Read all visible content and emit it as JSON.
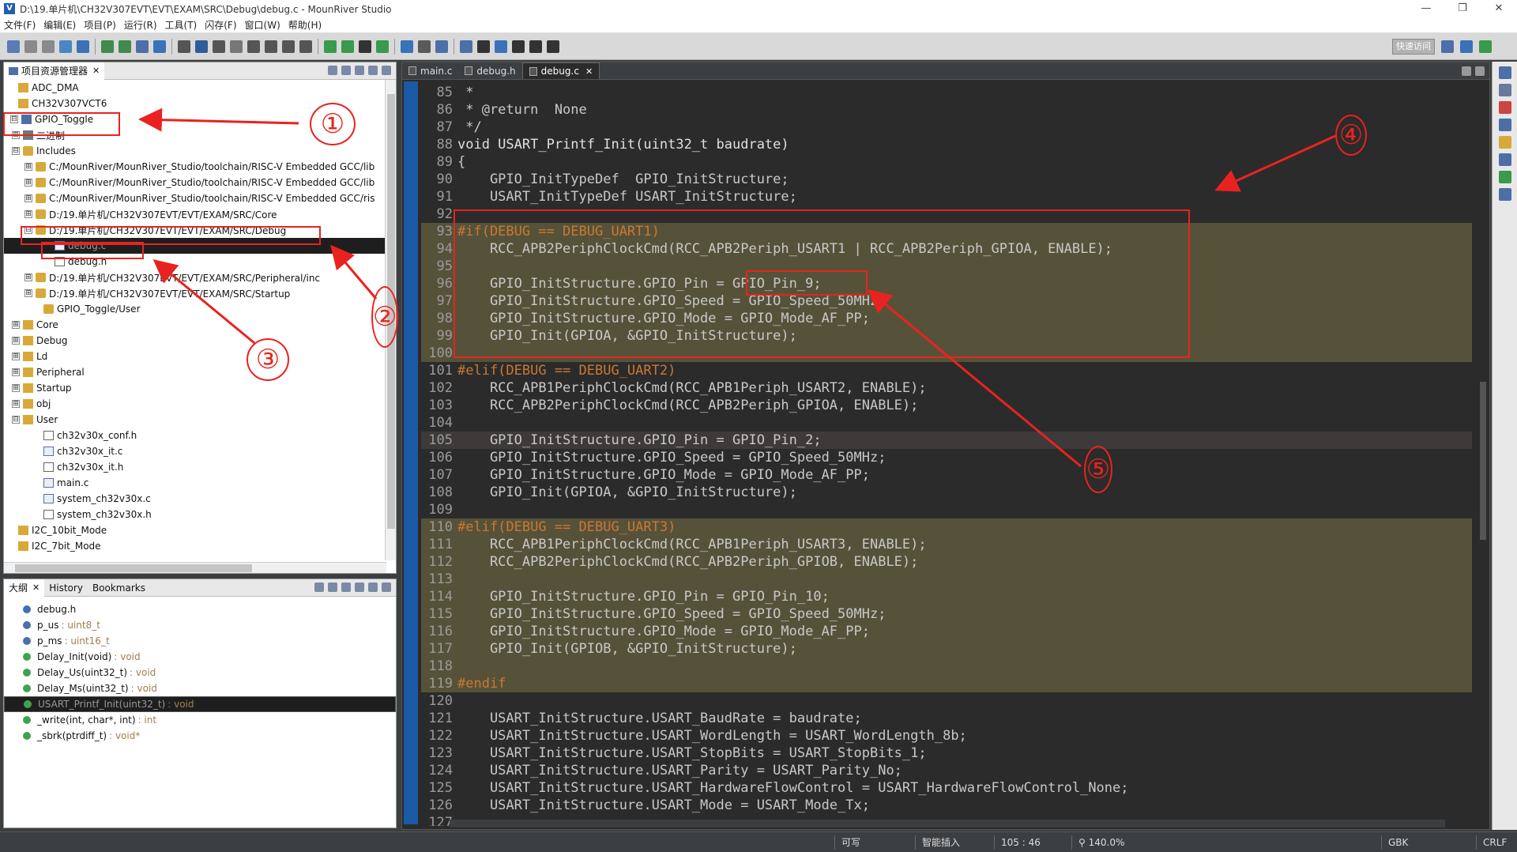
{
  "window": {
    "title": "D:\\19.单片机\\CH32V307EVT\\EVT\\EXAM\\SRC\\Debug\\debug.c - MounRiver Studio",
    "min": "—",
    "max": "❐",
    "close": "✕"
  },
  "menu": [
    "文件(F)",
    "编辑(E)",
    "项目(P)",
    "运行(R)",
    "工具(T)",
    "闪存(F)",
    "窗口(W)",
    "帮助(H)"
  ],
  "toolbar": {
    "quick_access": "快速访问"
  },
  "explorer": {
    "tab_label": "项目资源管理器",
    "rows": [
      {
        "label": "ADC_DMA",
        "icon": "folder-icon"
      },
      {
        "label": "CH32V307VCT6",
        "icon": "folder-icon"
      },
      {
        "label": "GPIO_Toggle",
        "icon": "project-icon",
        "toggle": "⊟"
      },
      {
        "label": "二进制",
        "icon": "binary-icon",
        "toggle": "⊞"
      },
      {
        "label": "Includes",
        "icon": "includes-icon",
        "toggle": "⊟"
      },
      {
        "label": "C:/MounRiver/MounRiver_Studio/toolchain/RISC-V Embedded GCC/lib",
        "icon": "include-folder-icon",
        "toggle": "⊞"
      },
      {
        "label": "C:/MounRiver/MounRiver_Studio/toolchain/RISC-V Embedded GCC/lib",
        "icon": "include-folder-icon",
        "toggle": "⊞"
      },
      {
        "label": "C:/MounRiver/MounRiver_Studio/toolchain/RISC-V Embedded GCC/ris",
        "icon": "include-folder-icon",
        "toggle": "⊞"
      },
      {
        "label": "D:/19.单片机/CH32V307EVT/EVT/EXAM/SRC/Core",
        "icon": "include-folder-icon",
        "toggle": "⊞"
      },
      {
        "label": "D:/19.单片机/CH32V307EVT/EVT/EXAM/SRC/Debug",
        "icon": "include-folder-icon",
        "toggle": "⊟"
      },
      {
        "label": "debug.c",
        "icon": "c-file-icon",
        "selected": true
      },
      {
        "label": "debug.h",
        "icon": "h-file-icon"
      },
      {
        "label": "D:/19.单片机/CH32V307EVT/EVT/EXAM/SRC/Peripheral/inc",
        "icon": "include-folder-icon",
        "toggle": "⊞"
      },
      {
        "label": "D:/19.单片机/CH32V307EVT/EVT/EXAM/SRC/Startup",
        "icon": "include-folder-icon",
        "toggle": "⊞"
      },
      {
        "label": "GPIO_Toggle/User",
        "icon": "include-folder-icon"
      },
      {
        "label": "Core",
        "icon": "folder-icon",
        "toggle": "⊞"
      },
      {
        "label": "Debug",
        "icon": "folder-icon",
        "toggle": "⊞"
      },
      {
        "label": "Ld",
        "icon": "folder-icon",
        "toggle": "⊞"
      },
      {
        "label": "Peripheral",
        "icon": "folder-icon",
        "toggle": "⊞"
      },
      {
        "label": "Startup",
        "icon": "folder-icon",
        "toggle": "⊞"
      },
      {
        "label": "obj",
        "icon": "folder-icon",
        "toggle": "⊞"
      },
      {
        "label": "User",
        "icon": "folder-icon",
        "toggle": "⊟"
      },
      {
        "label": "ch32v30x_conf.h",
        "icon": "h-file-icon"
      },
      {
        "label": "ch32v30x_it.c",
        "icon": "c-file-icon"
      },
      {
        "label": "ch32v30x_it.h",
        "icon": "h-file-icon"
      },
      {
        "label": "main.c",
        "icon": "c-file-icon"
      },
      {
        "label": "system_ch32v30x.c",
        "icon": "c-file-icon"
      },
      {
        "label": "system_ch32v30x.h",
        "icon": "h-file-icon"
      },
      {
        "label": "I2C_10bit_Mode",
        "icon": "folder-icon"
      },
      {
        "label": "I2C_7bit_Mode",
        "icon": "folder-icon"
      }
    ]
  },
  "outline": {
    "tabs": [
      "大纲",
      "History",
      "Bookmarks"
    ],
    "rows": [
      {
        "label": "debug.h",
        "type": ""
      },
      {
        "label": "p_us",
        "type": ": uint8_t"
      },
      {
        "label": "p_ms",
        "type": ": uint16_t"
      },
      {
        "label": "Delay_Init(void)",
        "type": ": void"
      },
      {
        "label": "Delay_Us(uint32_t)",
        "type": ": void"
      },
      {
        "label": "Delay_Ms(uint32_t)",
        "type": ": void"
      },
      {
        "label": "USART_Printf_Init(uint32_t)",
        "type": ": void",
        "selected": true
      },
      {
        "label": "_write(int, char*, int)",
        "type": ": int"
      },
      {
        "label": "_sbrk(ptrdiff_t)",
        "type": ": void*"
      }
    ]
  },
  "editor": {
    "tabs": [
      {
        "label": "main.c"
      },
      {
        "label": "debug.h"
      },
      {
        "label": "debug.c",
        "active": true
      }
    ],
    "lines": [
      {
        "n": "85",
        "t": " *"
      },
      {
        "n": "86",
        "t": " * @return  None"
      },
      {
        "n": "87",
        "t": " */"
      },
      {
        "n": "88",
        "t": "void USART_Printf_Init(uint32_t baudrate)"
      },
      {
        "n": "89",
        "t": "{"
      },
      {
        "n": "90",
        "t": "    GPIO_InitTypeDef  GPIO_InitStructure;"
      },
      {
        "n": "91",
        "t": "    USART_InitTypeDef USART_InitStructure;"
      },
      {
        "n": "92",
        "t": ""
      },
      {
        "n": "93",
        "t": "#if(DEBUG == DEBUG_UART1)"
      },
      {
        "n": "94",
        "t": "    RCC_APB2PeriphClockCmd(RCC_APB2Periph_USART1 | RCC_APB2Periph_GPIOA, ENABLE);"
      },
      {
        "n": "95",
        "t": ""
      },
      {
        "n": "96",
        "t": "    GPIO_InitStructure.GPIO_Pin = GPIO_Pin_9;"
      },
      {
        "n": "97",
        "t": "    GPIO_InitStructure.GPIO_Speed = GPIO_Speed_50MHz;"
      },
      {
        "n": "98",
        "t": "    GPIO_InitStructure.GPIO_Mode = GPIO_Mode_AF_PP;"
      },
      {
        "n": "99",
        "t": "    GPIO_Init(GPIOA, &GPIO_InitStructure);"
      },
      {
        "n": "100",
        "t": ""
      },
      {
        "n": "101",
        "t": "#elif(DEBUG == DEBUG_UART2)"
      },
      {
        "n": "102",
        "t": "    RCC_APB1PeriphClockCmd(RCC_APB1Periph_USART2, ENABLE);"
      },
      {
        "n": "103",
        "t": "    RCC_APB2PeriphClockCmd(RCC_APB2Periph_GPIOA, ENABLE);"
      },
      {
        "n": "104",
        "t": ""
      },
      {
        "n": "105",
        "t": "    GPIO_InitStructure.GPIO_Pin = GPIO_Pin_2;"
      },
      {
        "n": "106",
        "t": "    GPIO_InitStructure.GPIO_Speed = GPIO_Speed_50MHz;"
      },
      {
        "n": "107",
        "t": "    GPIO_InitStructure.GPIO_Mode = GPIO_Mode_AF_PP;"
      },
      {
        "n": "108",
        "t": "    GPIO_Init(GPIOA, &GPIO_InitStructure);"
      },
      {
        "n": "109",
        "t": ""
      },
      {
        "n": "110",
        "t": "#elif(DEBUG == DEBUG_UART3)"
      },
      {
        "n": "111",
        "t": "    RCC_APB1PeriphClockCmd(RCC_APB1Periph_USART3, ENABLE);"
      },
      {
        "n": "112",
        "t": "    RCC_APB2PeriphClockCmd(RCC_APB2Periph_GPIOB, ENABLE);"
      },
      {
        "n": "113",
        "t": ""
      },
      {
        "n": "114",
        "t": "    GPIO_InitStructure.GPIO_Pin = GPIO_Pin_10;"
      },
      {
        "n": "115",
        "t": "    GPIO_InitStructure.GPIO_Speed = GPIO_Speed_50MHz;"
      },
      {
        "n": "116",
        "t": "    GPIO_InitStructure.GPIO_Mode = GPIO_Mode_AF_PP;"
      },
      {
        "n": "117",
        "t": "    GPIO_Init(GPIOB, &GPIO_InitStructure);"
      },
      {
        "n": "118",
        "t": ""
      },
      {
        "n": "119",
        "t": "#endif"
      },
      {
        "n": "120",
        "t": ""
      },
      {
        "n": "121",
        "t": "    USART_InitStructure.USART_BaudRate = baudrate;"
      },
      {
        "n": "122",
        "t": "    USART_InitStructure.USART_WordLength = USART_WordLength_8b;"
      },
      {
        "n": "123",
        "t": "    USART_InitStructure.USART_StopBits = USART_StopBits_1;"
      },
      {
        "n": "124",
        "t": "    USART_InitStructure.USART_Parity = USART_Parity_No;"
      },
      {
        "n": "125",
        "t": "    USART_InitStructure.USART_HardwareFlowControl = USART_HardwareFlowControl_None;"
      },
      {
        "n": "126",
        "t": "    USART_InitStructure.USART_Mode = USART_Mode_Tx;"
      },
      {
        "n": "127",
        "t": ""
      }
    ]
  },
  "status": {
    "writable": "可写",
    "insert": "智能插入",
    "position": "105 : 46",
    "zoom": "140.0%",
    "encoding": "GBK",
    "eol": "CRLF"
  },
  "annotations": [
    "①",
    "②",
    "③",
    "④",
    "⑤"
  ],
  "colors": {
    "annotation": "#e8231f",
    "editor_bg": "#2b2b2b",
    "inactive_block": "#56523a",
    "gutter": "#1b5aa6"
  }
}
